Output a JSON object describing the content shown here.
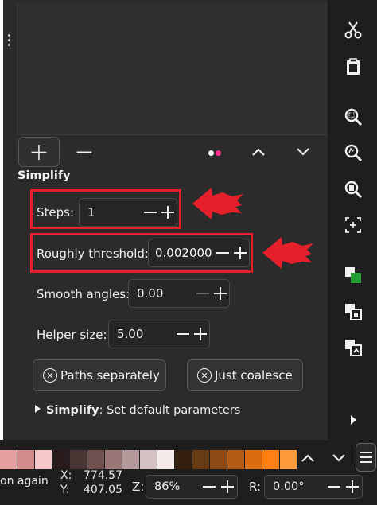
{
  "panel": {
    "section_title": "Simplify",
    "add_label": "+",
    "remove_label": "−"
  },
  "params": {
    "steps": {
      "label": "Steps:",
      "value": "1"
    },
    "threshold": {
      "label": "Roughly threshold:",
      "value": "0.002000"
    },
    "smooth": {
      "label": "Smooth angles:",
      "value": "0.00"
    },
    "helper": {
      "label": "Helper size:",
      "value": "5.00"
    }
  },
  "buttons": {
    "paths_separately": "Paths separately",
    "just_coalesce": "Just coalesce"
  },
  "footer": {
    "name": "Simplify",
    "text": ": Set default parameters"
  },
  "toolbar_icons": [
    "scissors-icon",
    "clipboard-icon",
    "zoom-selection-icon",
    "zoom-drawing-icon",
    "zoom-page-icon",
    "zoom-fit-icon",
    "duplicate-icon",
    "clone-icon",
    "unlink-clone-icon",
    "more-arrow-icon"
  ],
  "palette_colors": [
    "#e6a0a0",
    "#d28c8c",
    "#f5c9c9",
    "#2a1c1c",
    "#4a3434",
    "#6e5050",
    "#9a7676",
    "#b49a9a",
    "#d4c2c2",
    "#f6eaea",
    "#341e0e",
    "#6a3c16",
    "#8c4a16",
    "#b45a14",
    "#dc6c10",
    "#ff7f14",
    "#ff9a3c"
  ],
  "status": {
    "message": "on again",
    "x_label": "X:",
    "x_value": "774.57",
    "y_label": "Y:",
    "y_value": "407.05",
    "zoom_label": "Z:",
    "zoom_value": "86%",
    "rotate_label": "R:",
    "rotate_value": "0.00°"
  },
  "colors": {
    "highlight": "#e6202a",
    "dot_white": "#ffffff",
    "dot_pink": "#ff2f8e"
  }
}
